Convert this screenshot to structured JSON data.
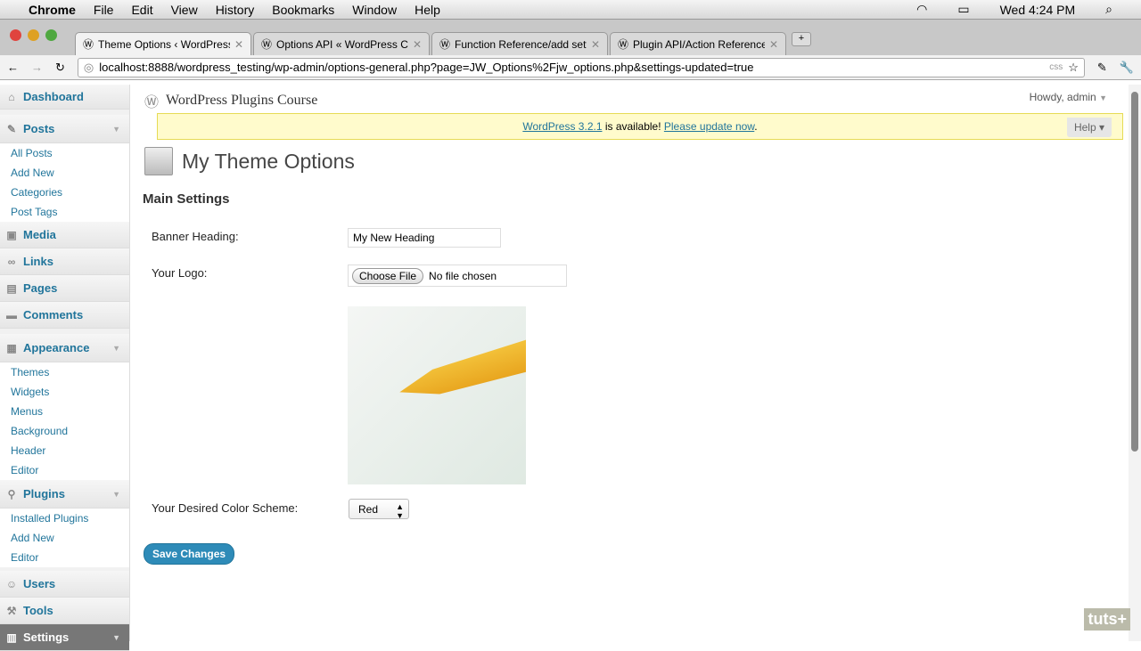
{
  "menubar": {
    "app": "Chrome",
    "items": [
      "File",
      "Edit",
      "View",
      "History",
      "Bookmarks",
      "Window",
      "Help"
    ],
    "clock": "Wed 4:24 PM"
  },
  "tabs": [
    {
      "title": "Theme Options ‹ WordPress"
    },
    {
      "title": "Options API « WordPress Co"
    },
    {
      "title": "Function Reference/add setti"
    },
    {
      "title": "Plugin API/Action Reference"
    }
  ],
  "url": "localhost:8888/wordpress_testing/wp-admin/options-general.php?page=JW_Options%2Fjw_options.php&settings-updated=true",
  "sidebar": {
    "dashboard": "Dashboard",
    "posts": "Posts",
    "posts_sub": [
      "All Posts",
      "Add New",
      "Categories",
      "Post Tags"
    ],
    "media": "Media",
    "links": "Links",
    "pages": "Pages",
    "comments": "Comments",
    "appearance": "Appearance",
    "appearance_sub": [
      "Themes",
      "Widgets",
      "Menus",
      "Background",
      "Header",
      "Editor"
    ],
    "plugins": "Plugins",
    "plugins_sub": [
      "Installed Plugins",
      "Add New",
      "Editor"
    ],
    "users": "Users",
    "tools": "Tools",
    "settings": "Settings"
  },
  "header": {
    "site": "WordPress Plugins Course",
    "howdy": "Howdy, admin",
    "help": "Help"
  },
  "notice": {
    "link1": "WordPress 3.2.1",
    "text": " is available! ",
    "link2": "Please update now",
    "end": "."
  },
  "page": {
    "title": "My Theme Options",
    "section": "Main Settings",
    "banner_label": "Banner Heading:",
    "banner_value": "My New Heading",
    "logo_label": "Your Logo:",
    "choose_file": "Choose File",
    "no_file": "No file chosen",
    "color_label": "Your Desired Color Scheme:",
    "color_value": "Red",
    "save": "Save Changes"
  },
  "watermark": "tuts+"
}
